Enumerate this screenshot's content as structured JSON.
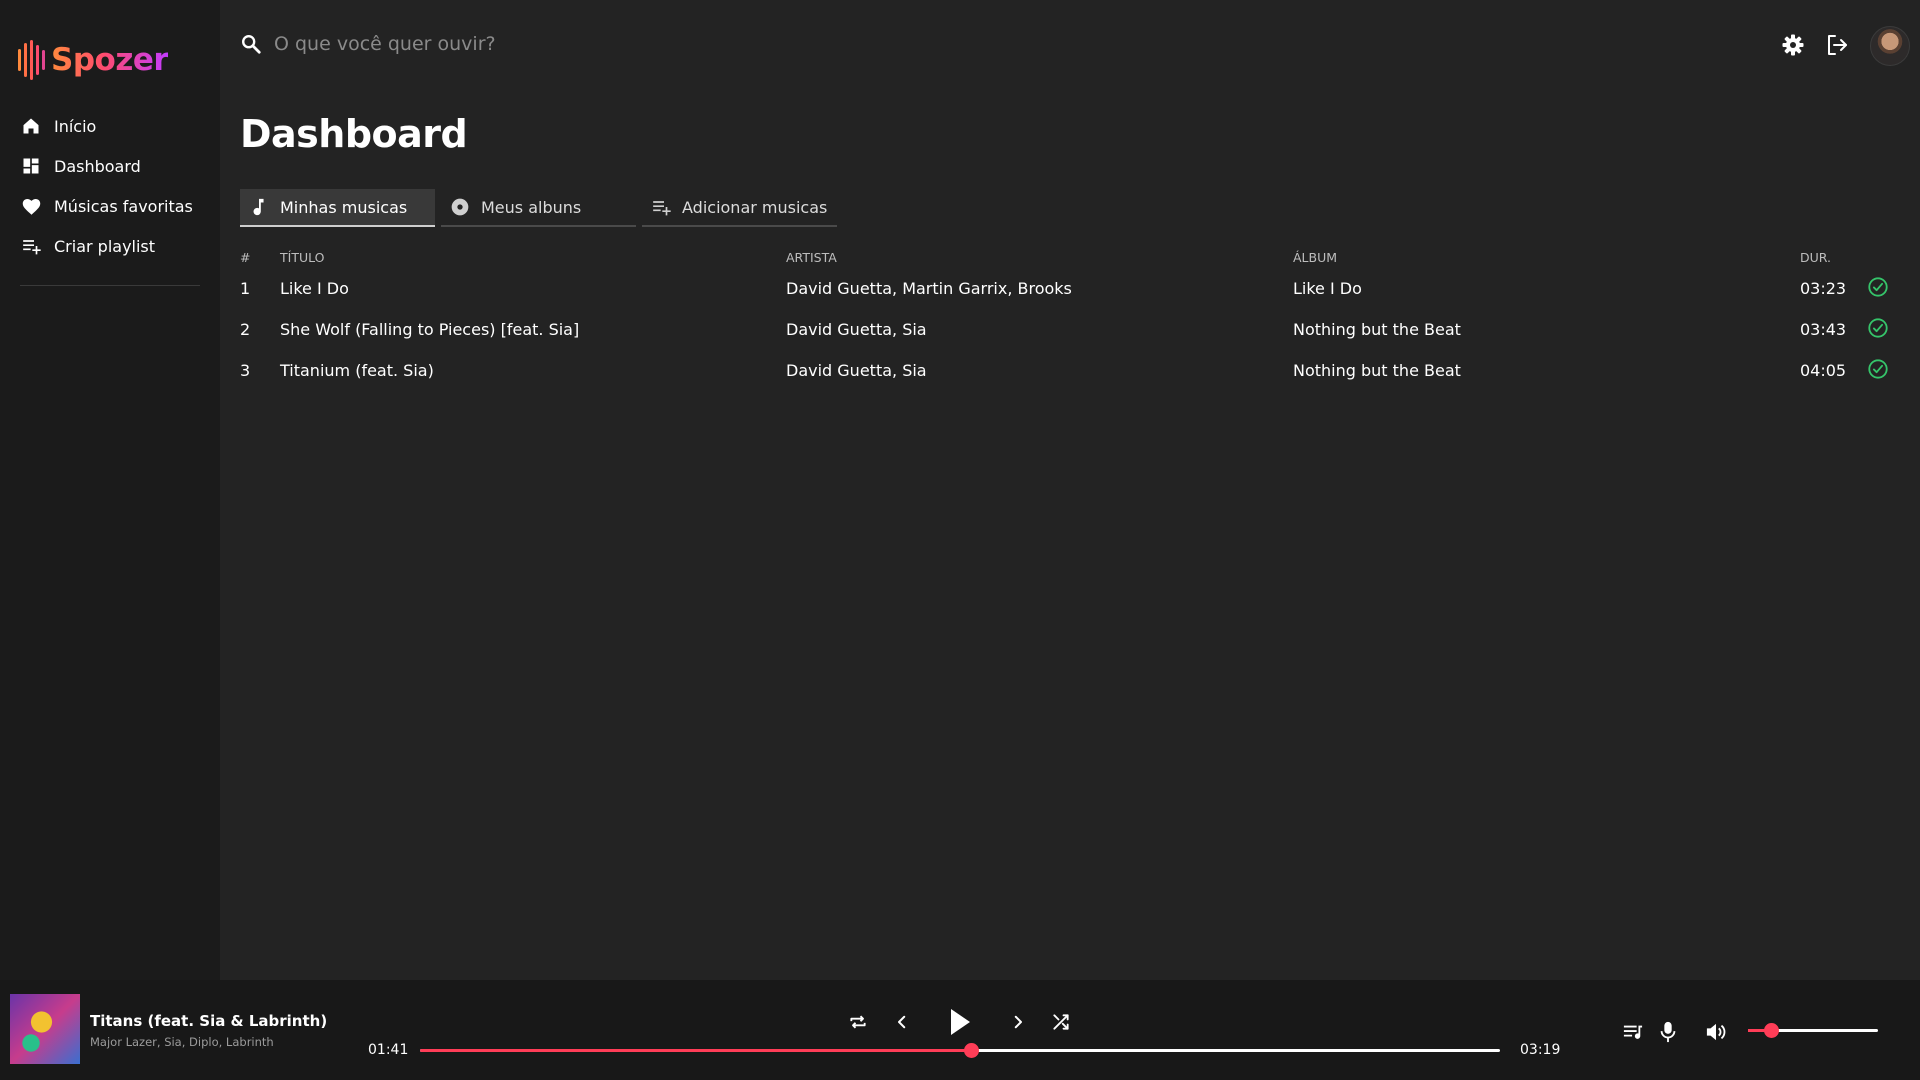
{
  "app": {
    "name": "Spozer",
    "colors": {
      "accent": "#ff3d57",
      "check": "#35c46a",
      "logo_start": "#ff8a3d",
      "logo_end": "#c33bff"
    }
  },
  "sidebar": {
    "items": [
      {
        "label": "Início",
        "icon": "home-icon"
      },
      {
        "label": "Dashboard",
        "icon": "dashboard-icon"
      },
      {
        "label": "Músicas favoritas",
        "icon": "heart-icon"
      },
      {
        "label": "Criar playlist",
        "icon": "playlist-add-icon"
      }
    ]
  },
  "search": {
    "placeholder": "O que você quer ouvir?"
  },
  "header_icons": [
    "gear-icon",
    "logout-icon"
  ],
  "main": {
    "title": "Dashboard",
    "tabs": [
      {
        "label": "Minhas musicas",
        "icon": "music-note-icon",
        "active": true
      },
      {
        "label": "Meus albuns",
        "icon": "disc-icon",
        "active": false
      },
      {
        "label": "Adicionar musicas",
        "icon": "playlist-add-icon",
        "active": false
      }
    ],
    "table": {
      "headers": {
        "num": "#",
        "title": "Título",
        "artist": "Artista",
        "album": "Álbum",
        "duration": "Dur."
      },
      "rows": [
        {
          "num": "1",
          "title": "Like I Do",
          "artists": [
            "David Guetta",
            "Martin Garrix",
            "Brooks"
          ],
          "album": "Like I Do",
          "duration": "03:23"
        },
        {
          "num": "2",
          "title": "She Wolf (Falling to Pieces) [feat. Sia]",
          "artists": [
            "David Guetta",
            "Sia"
          ],
          "album": "Nothing but the Beat",
          "duration": "03:43"
        },
        {
          "num": "3",
          "title": "Titanium (feat. Sia)",
          "artists": [
            "David Guetta",
            "Sia"
          ],
          "album": "Nothing but the Beat",
          "duration": "04:05"
        }
      ]
    }
  },
  "player": {
    "title": "Titans (feat. Sia & Labrinth)",
    "artists": "Major Lazer, Sia, Diplo, Labrinth",
    "current_time": "01:41",
    "total_time": "03:19",
    "progress": 0.51,
    "volume": 0.18
  }
}
